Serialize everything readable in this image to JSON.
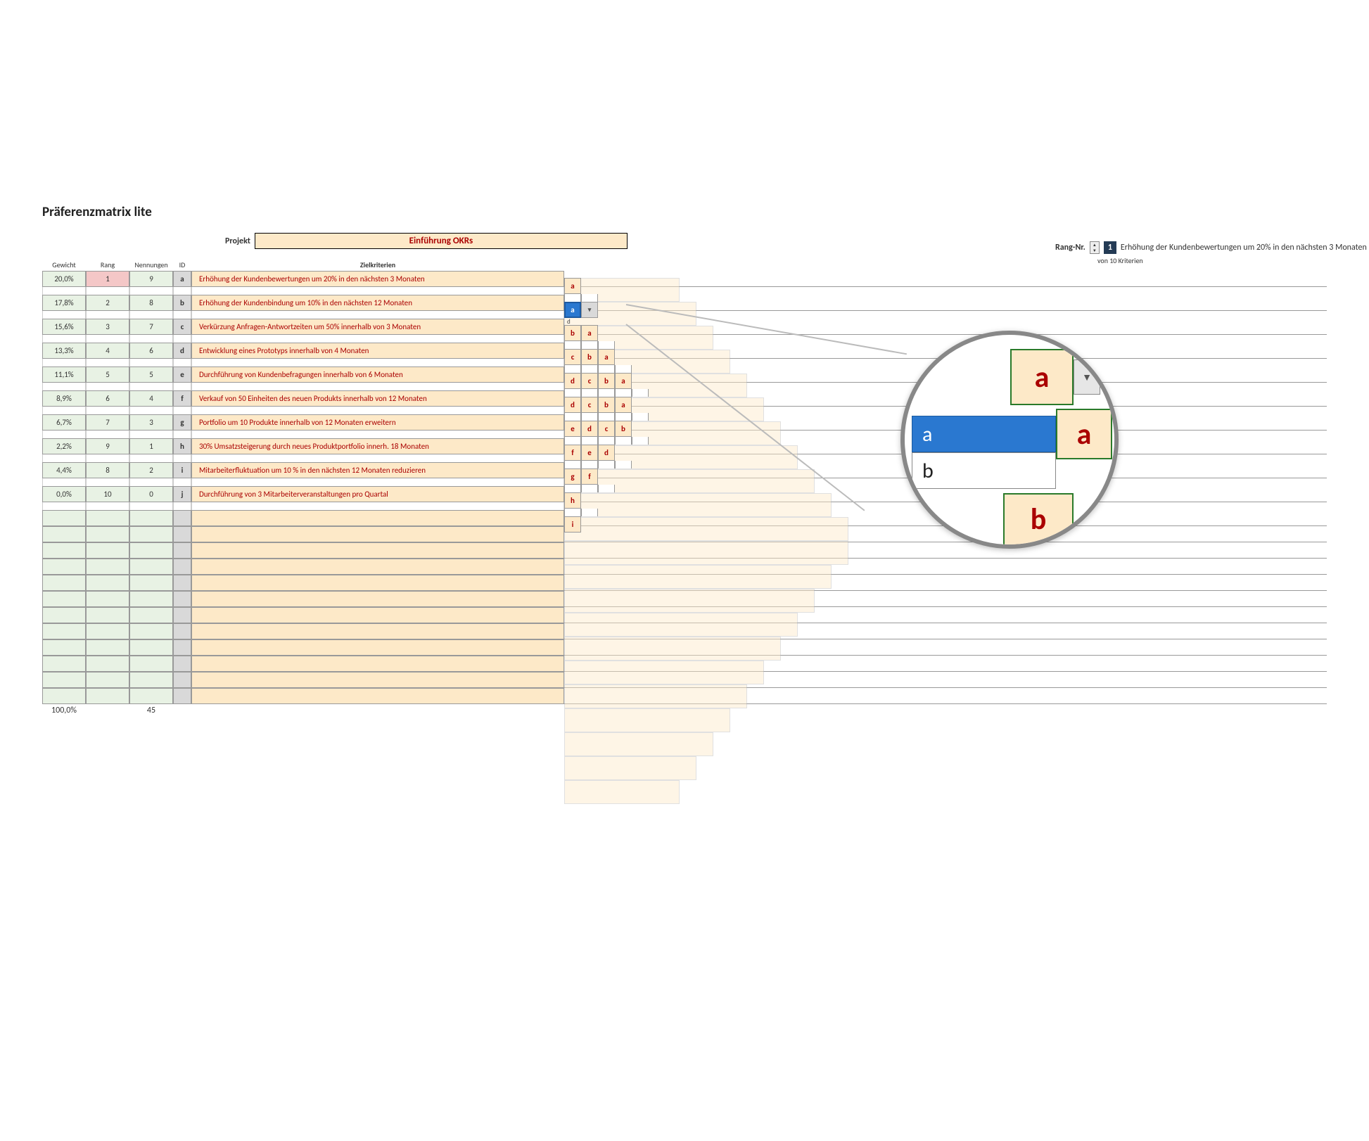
{
  "title": "Präferenzmatrix lite",
  "project_label": "Projekt",
  "project_value": "Einführung OKRs",
  "headers": {
    "gewicht": "Gewicht",
    "rang": "Rang",
    "nennungen": "Nennungen",
    "id": "ID",
    "ziel": "Zielkriterien"
  },
  "criteria": [
    {
      "gewicht": "20,0%",
      "rang": "1",
      "nennungen": "9",
      "id": "a",
      "text": "Erhöhung der Kundenbewertungen um 20% in den nächsten 3 Monaten",
      "top": true
    },
    {
      "gewicht": "17,8%",
      "rang": "2",
      "nennungen": "8",
      "id": "b",
      "text": "Erhöhung der Kundenbindung um 10% in den nächsten 12 Monaten"
    },
    {
      "gewicht": "15,6%",
      "rang": "3",
      "nennungen": "7",
      "id": "c",
      "text": "Verkürzung Anfragen-Antwortzeiten um 50% innerhalb von 3 Monaten"
    },
    {
      "gewicht": "13,3%",
      "rang": "4",
      "nennungen": "6",
      "id": "d",
      "text": "Entwicklung eines Prototyps innerhalb von 4 Monaten"
    },
    {
      "gewicht": "11,1%",
      "rang": "5",
      "nennungen": "5",
      "id": "e",
      "text": "Durchführung von Kundenbefragungen innerhalb von 6 Monaten"
    },
    {
      "gewicht": "8,9%",
      "rang": "6",
      "nennungen": "4",
      "id": "f",
      "text": "Verkauf von 50 Einheiten des neuen Produkts innerhalb von 12 Monaten"
    },
    {
      "gewicht": "6,7%",
      "rang": "7",
      "nennungen": "3",
      "id": "g",
      "text": "Portfolio um 10 Produkte innerhalb von 12 Monaten erweitern"
    },
    {
      "gewicht": "2,2%",
      "rang": "9",
      "nennungen": "1",
      "id": "h",
      "text": "30% Umsatzsteigerung durch neues Produktportfolio innerh. 18 Monaten"
    },
    {
      "gewicht": "4,4%",
      "rang": "8",
      "nennungen": "2",
      "id": "i",
      "text": "Mitarbeiterfluktuation um 10 % in den nächsten 12 Monaten reduzieren"
    },
    {
      "gewicht": "0,0%",
      "rang": "10",
      "nennungen": "0",
      "id": "j",
      "text": "Durchführung von 3 Mitarbeiterveranstaltungen pro Quartal"
    }
  ],
  "empty_rows": 12,
  "totals": {
    "gewicht": "100,0%",
    "nennungen": "45"
  },
  "matrix": [
    [
      "a"
    ],
    [
      "a!sel",
      "▾!arrow"
    ],
    [
      "b",
      "a"
    ],
    [
      "c",
      "b",
      "a"
    ],
    [
      "d",
      "c",
      "b",
      "a"
    ],
    [
      "d",
      "c",
      "b",
      "a"
    ],
    [
      "e",
      "d",
      "c",
      "b"
    ],
    [
      "f",
      "e",
      "d"
    ],
    [
      "g",
      "f"
    ],
    [
      "h"
    ],
    [
      "i"
    ]
  ],
  "matrix_ids": [
    "a",
    "b",
    "c",
    "d",
    "e",
    "f",
    "g",
    "h",
    "i",
    "j"
  ],
  "dropdown_hint": "d",
  "rang": {
    "label": "Rang-Nr.",
    "value": "1",
    "desc": "Erhöhung der Kundenbewertungen um 20% in den nächsten 3 Monaten",
    "sub_pre": "von",
    "sub_n": "10",
    "sub_post": "Kriterien"
  },
  "magnifier": {
    "big": "a",
    "sel": "a",
    "opt": "b",
    "side": "a",
    "bottom": "b"
  }
}
